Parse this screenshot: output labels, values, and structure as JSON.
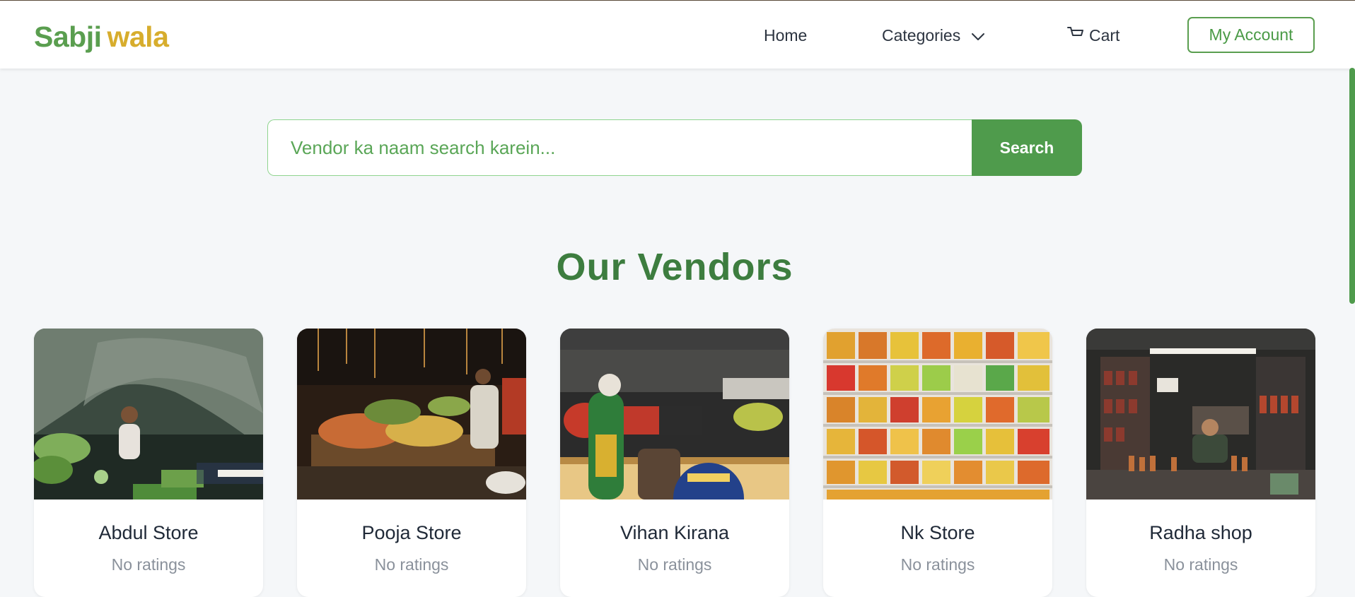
{
  "header": {
    "logo_part1": "Sabji",
    "logo_part2": "wala",
    "nav": {
      "home": "Home",
      "categories": "Categories",
      "cart": "Cart"
    },
    "account_label": "My Account"
  },
  "search": {
    "placeholder": "Vendor ka naam search karein...",
    "value": "",
    "button_label": "Search"
  },
  "vendors_section": {
    "title": "Our Vendors",
    "vendors": [
      {
        "name": "Abdul Store",
        "rating": "No ratings"
      },
      {
        "name": "Pooja Store",
        "rating": "No ratings"
      },
      {
        "name": "Vihan Kirana",
        "rating": "No ratings"
      },
      {
        "name": "Nk Store",
        "rating": "No ratings"
      },
      {
        "name": "Radha shop",
        "rating": "No ratings"
      }
    ]
  },
  "colors": {
    "brand_green": "#4f9b4c",
    "brand_yellow": "#d7ad2d",
    "heading_green": "#3d7d3f",
    "page_background": "#f5f7f9"
  }
}
